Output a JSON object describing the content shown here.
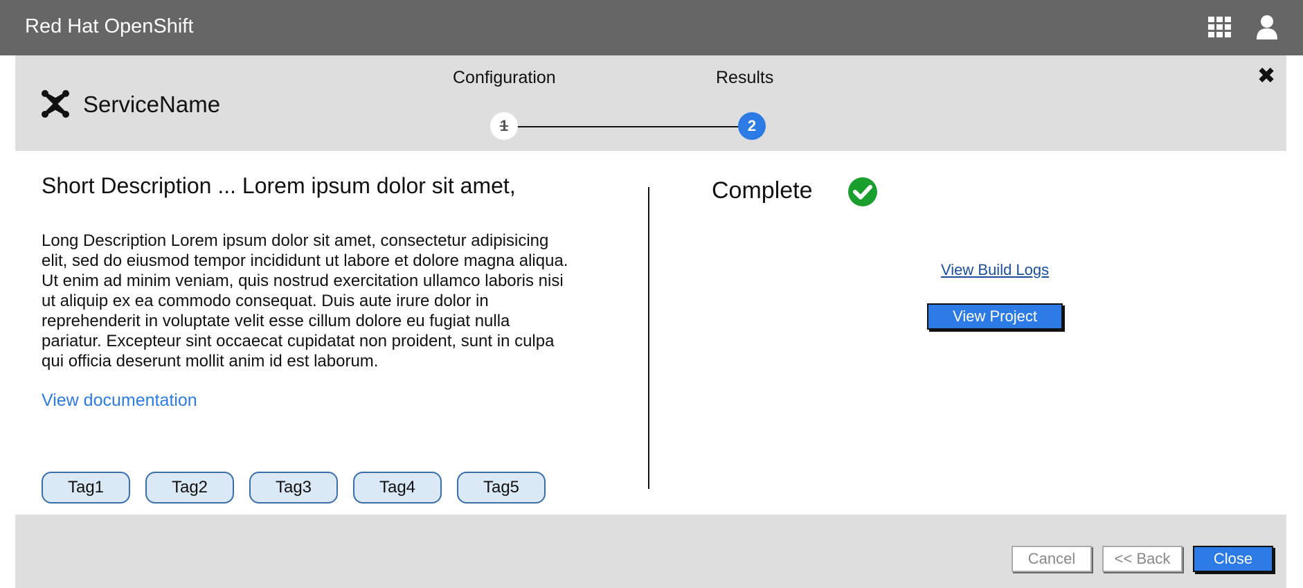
{
  "topbar": {
    "brand": "Red Hat OpenShift",
    "apps_icon": "grid-icon",
    "user_icon": "user-icon",
    "background": "#666666"
  },
  "header": {
    "service_icon": "joomla-icon",
    "service_name": "ServiceName",
    "close_icon": "close-icon",
    "close_glyph": "✖",
    "steps": [
      {
        "label": "Configuration",
        "number": "1",
        "state": "completed"
      },
      {
        "label": "Results",
        "number": "2",
        "state": "active"
      }
    ]
  },
  "main": {
    "short_description": "Short Description ... Lorem ipsum dolor sit amet,",
    "long_description_lines": [
      "Long Description Lorem ipsum dolor sit amet, consectetur adipisicing",
      "elit, sed do eiusmod tempor incididunt ut labore et dolore magna aliqua.",
      "Ut enim ad minim veniam, quis nostrud exercitation ullamco laboris nisi",
      "ut aliquip ex ea commodo consequat. Duis aute irure dolor in",
      "reprehenderit in voluptate velit esse cillum dolore eu fugiat nulla",
      "pariatur. Excepteur sint occaecat cupidatat non proident, sunt in culpa",
      "qui officia deserunt mollit anim id est laborum."
    ],
    "doc_link": "View documentation",
    "tags": [
      "Tag1",
      "Tag2",
      "Tag3",
      "Tag4",
      "Tag5"
    ]
  },
  "results": {
    "status": "Complete",
    "status_icon": "check-circle-icon",
    "build_logs_link": "View Build Logs",
    "view_project_label": "View Project"
  },
  "footer": {
    "cancel_label": "Cancel",
    "back_label": "<< Back",
    "close_label": "Close"
  },
  "colors": {
    "accent": "#2c7ae4",
    "success": "#1a9e2e",
    "panel": "#dedede",
    "tag_fill": "#dbe8f5"
  }
}
